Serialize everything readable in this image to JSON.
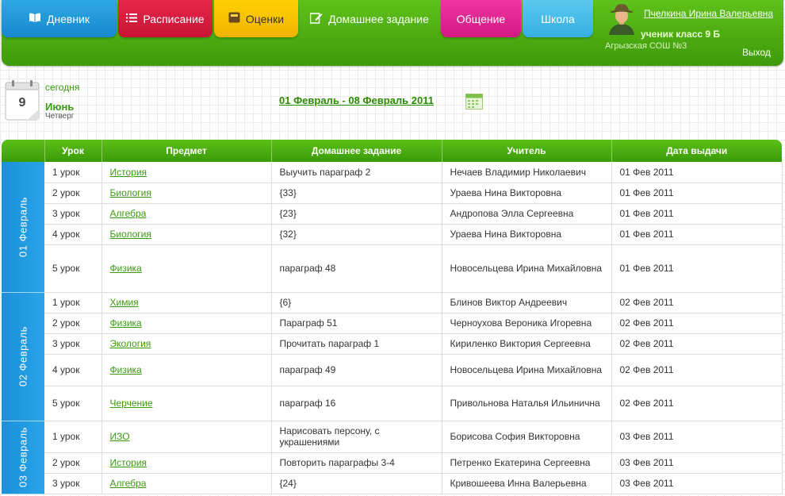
{
  "nav": {
    "tabs": [
      {
        "label": "Дневник",
        "icon": "book-icon"
      },
      {
        "label": "Расписание",
        "icon": "list-icon"
      },
      {
        "label": "Оценки",
        "icon": "grades-icon"
      },
      {
        "label": "Домашнее задание",
        "icon": "pencil-icon"
      },
      {
        "label": "Общение",
        "icon": ""
      },
      {
        "label": "Школа",
        "icon": ""
      }
    ],
    "active_tab": "Домашнее задание"
  },
  "user": {
    "name": "Пчелкина Ирина Валерьевна",
    "role": "ученик класс 9 Б",
    "school": "Агрызская СОШ №3",
    "logout": "Выход"
  },
  "today": {
    "label": "сегодня",
    "day": "9",
    "month": "Июнь",
    "weekday": "Четверг"
  },
  "week_range": "01 Февраль - 08 Февраль 2011",
  "table": {
    "headers": [
      "",
      "Урок",
      "Предмет",
      "Домашнее задание",
      "Учитель",
      "Дата выдачи"
    ],
    "groups": [
      {
        "date": "01 Февраль",
        "rows": [
          {
            "lesson": "1 урок",
            "subject": "История",
            "homework": "Выучить параграф 2",
            "teacher": "Нечаев Владимир Николаевич",
            "issued": "01 Фев 2011"
          },
          {
            "lesson": "2 урок",
            "subject": "Биология",
            "homework": "{33}",
            "teacher": "Ураева Нина Викторовна",
            "issued": "01 Фев 2011"
          },
          {
            "lesson": "3 урок",
            "subject": "Алгебра",
            "homework": "{23}",
            "teacher": "Андропова Элла Сергеевна",
            "issued": "01 Фев 2011"
          },
          {
            "lesson": "4 урок",
            "subject": "Биология",
            "homework": "{32}",
            "teacher": "Ураева Нина Викторовна",
            "issued": "01 Фев 2011"
          },
          {
            "lesson": "5 урок",
            "subject": "Физика",
            "homework": "параграф 48",
            "teacher": "Новосельцева Ирина Михайловна",
            "issued": "01 Фев 2011"
          }
        ]
      },
      {
        "date": "02 Февраль",
        "rows": [
          {
            "lesson": "1 урок",
            "subject": "Химия",
            "homework": "{6}",
            "teacher": "Блинов Виктор Андреевич",
            "issued": "02 Фев 2011"
          },
          {
            "lesson": "2 урок",
            "subject": "Физика",
            "homework": "Параграф 51",
            "teacher": "Черноухова Вероника Игоревна",
            "issued": "02 Фев 2011"
          },
          {
            "lesson": "3 урок",
            "subject": "Экология",
            "homework": "Прочитать параграф 1",
            "teacher": "Кириленко Виктория Сергеевна",
            "issued": "02 Фев 2011"
          },
          {
            "lesson": "4 урок",
            "subject": "Физика",
            "homework": "параграф 49",
            "teacher": "Новосельцева Ирина Михайловна",
            "issued": "02 Фев 2011"
          },
          {
            "lesson": "5 урок",
            "subject": "Черчение",
            "homework": "параграф 16",
            "teacher": "Привольнова Наталья Ильинична",
            "issued": "02 Фев 2011"
          }
        ]
      },
      {
        "date": "03 Февраль",
        "rows": [
          {
            "lesson": "1 урок",
            "subject": "ИЗО",
            "homework": "Нарисовать персону, с украшениями",
            "teacher": "Борисова София Викторовна",
            "issued": "03 Фев 2011"
          },
          {
            "lesson": "2 урок",
            "subject": "История",
            "homework": "Повторить параграфы 3-4",
            "teacher": "Петренко Екатерина Сергеевна",
            "issued": "03 Фев 2011"
          },
          {
            "lesson": "3 урок",
            "subject": "Алгебра",
            "homework": "{24}",
            "teacher": "Кривошеева Инна Валерьевна",
            "issued": "03 Фев 2011"
          }
        ]
      }
    ]
  }
}
